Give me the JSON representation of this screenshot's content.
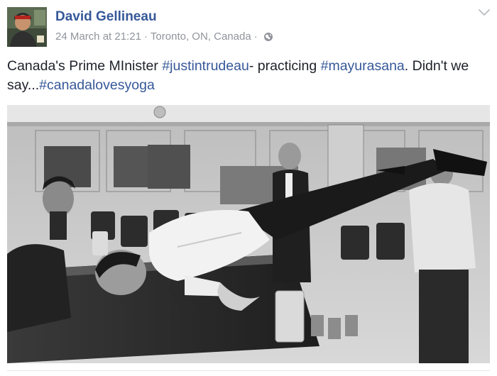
{
  "post": {
    "author": "David Gellineau",
    "date": "24 March at 21:21",
    "location": "Toronto, ON, Canada",
    "audience_icon": "globe-icon",
    "text_segments": [
      {
        "text": "Canada's Prime MInister ",
        "type": "text"
      },
      {
        "text": "#justintrudeau",
        "type": "hashtag"
      },
      {
        "text": "- practicing ",
        "type": "text"
      },
      {
        "text": "#mayurasana",
        "type": "hashtag"
      },
      {
        "text": ". Didn't we say...",
        "type": "text"
      },
      {
        "text": "#canadalovesyoga",
        "type": "hashtag"
      }
    ]
  },
  "colors": {
    "link": "#365899",
    "meta": "#90949c",
    "text": "#1d2129"
  }
}
